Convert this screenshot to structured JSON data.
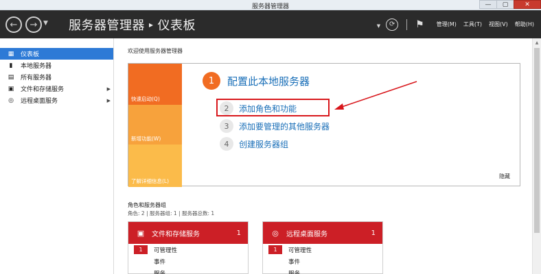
{
  "window": {
    "title": "服务器管理器",
    "controls": [
      "—",
      "▢",
      "✕"
    ]
  },
  "toolbar": {
    "breadcrumb_app": "服务器管理器",
    "breadcrumb_sep": "▸",
    "breadcrumb_page": "仪表板",
    "menus": [
      "管理(M)",
      "工具(T)",
      "视图(V)",
      "帮助(H)"
    ]
  },
  "sidebar": {
    "items": [
      {
        "label": "仪表板",
        "icon": "dashboard-icon"
      },
      {
        "label": "本地服务器",
        "icon": "server-icon"
      },
      {
        "label": "所有服务器",
        "icon": "servers-icon"
      },
      {
        "label": "文件和存储服务",
        "icon": "storage-icon"
      },
      {
        "label": "远程桌面服务",
        "icon": "remote-desktop-icon"
      }
    ]
  },
  "welcome": {
    "title": "欢迎使用服务器管理器",
    "tiles": [
      "快速启动(Q)",
      "新增功能(W)",
      "了解详细信息(L)"
    ],
    "main_step": {
      "num": "1",
      "label": "配置此本地服务器"
    },
    "steps": [
      {
        "num": "2",
        "label": "添加角色和功能"
      },
      {
        "num": "3",
        "label": "添加要管理的其他服务器"
      },
      {
        "num": "4",
        "label": "创建服务器组"
      }
    ],
    "hide": "隐藏"
  },
  "roles": {
    "title": "角色和服务器组",
    "subtitle": "角色: 2 | 服务器组: 1 | 服务器总数: 1",
    "cards": [
      {
        "title": "文件和存储服务",
        "count": "1",
        "badge": "1",
        "rows": [
          "可管理性",
          "事件",
          "服务"
        ]
      },
      {
        "title": "远程桌面服务",
        "count": "1",
        "badge": "1",
        "rows": [
          "可管理性",
          "事件",
          "服务"
        ]
      }
    ]
  },
  "colors": {
    "accent_orange": "#f16c22",
    "highlight_red": "#d8161b",
    "card_red": "#cc1f26",
    "sidebar_active": "#2d7ad6",
    "toolbar_bg": "#2b2b2b"
  }
}
